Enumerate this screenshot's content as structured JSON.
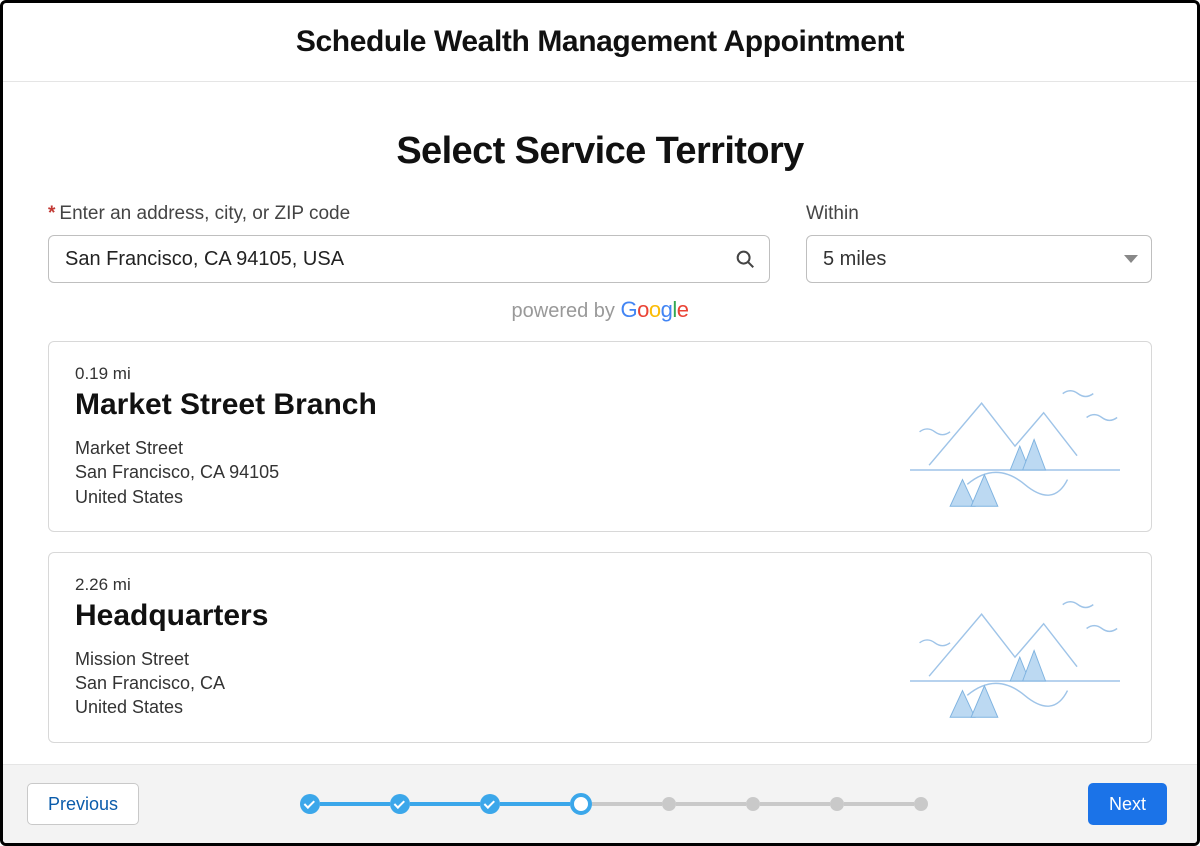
{
  "header": {
    "title": "Schedule Wealth Management Appointment"
  },
  "section": {
    "title": "Select Service Territory"
  },
  "address_field": {
    "label": "Enter an address, city, or ZIP code",
    "value": "San Francisco, CA 94105, USA"
  },
  "within_field": {
    "label": "Within",
    "value": "5 miles"
  },
  "powered": {
    "prefix": "powered by ",
    "brand": "Google"
  },
  "results": [
    {
      "distance": "0.19 mi",
      "name": "Market Street Branch",
      "addr1": "Market Street",
      "addr2": "San Francisco, CA 94105",
      "addr3": "United States"
    },
    {
      "distance": "2.26 mi",
      "name": "Headquarters",
      "addr1": "Mission Street",
      "addr2": "San Francisco, CA",
      "addr3": "United States"
    }
  ],
  "footer": {
    "previous": "Previous",
    "next": "Next"
  },
  "stepper": {
    "total": 8,
    "current_index": 3
  }
}
